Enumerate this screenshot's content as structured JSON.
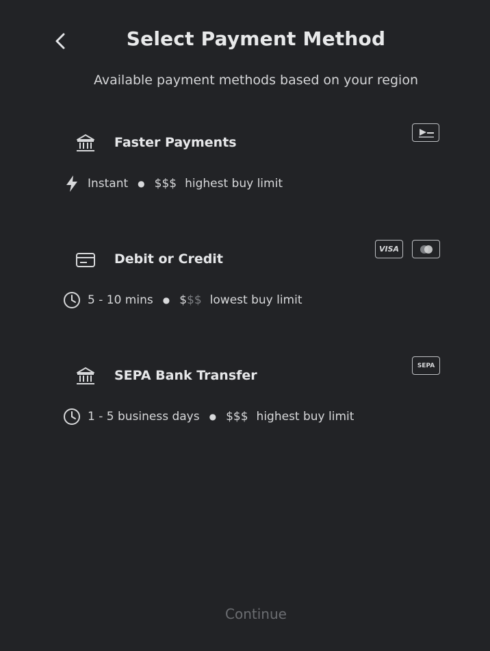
{
  "header": {
    "title": "Select Payment Method",
    "subtitle": "Available payment methods based on your region"
  },
  "methods": [
    {
      "name": "Faster Payments",
      "icon": "bank-icon",
      "meta_icon": "lightning-icon",
      "time": "Instant",
      "price_strong": "$$$",
      "price_dim": "",
      "limit": "highest buy limit",
      "badges": [
        "faster-payments-logo"
      ]
    },
    {
      "name": "Debit or Credit",
      "icon": "credit-card-icon",
      "meta_icon": "clock-icon",
      "time": "5 - 10 mins",
      "price_strong": "$",
      "price_dim": "$$",
      "limit": "lowest buy limit",
      "badges": [
        "visa-logo",
        "mastercard-logo"
      ],
      "visa_text": "VISA"
    },
    {
      "name": "SEPA Bank Transfer",
      "icon": "bank-icon",
      "meta_icon": "clock-icon",
      "time": "1 - 5 business days",
      "price_strong": "$$$",
      "price_dim": "",
      "limit": "highest buy limit",
      "badges": [
        "sepa-logo"
      ],
      "sepa_text": "SEPA"
    }
  ],
  "footer": {
    "continue_label": "Continue"
  }
}
